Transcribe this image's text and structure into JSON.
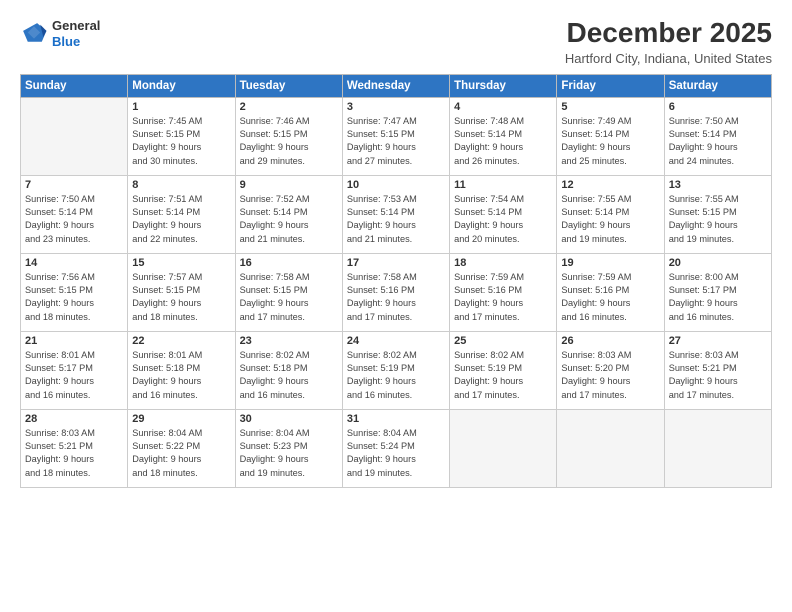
{
  "header": {
    "logo_line1": "General",
    "logo_line2": "Blue",
    "month": "December 2025",
    "location": "Hartford City, Indiana, United States"
  },
  "weekdays": [
    "Sunday",
    "Monday",
    "Tuesday",
    "Wednesday",
    "Thursday",
    "Friday",
    "Saturday"
  ],
  "weeks": [
    [
      {
        "num": "",
        "detail": ""
      },
      {
        "num": "1",
        "detail": "Sunrise: 7:45 AM\nSunset: 5:15 PM\nDaylight: 9 hours\nand 30 minutes."
      },
      {
        "num": "2",
        "detail": "Sunrise: 7:46 AM\nSunset: 5:15 PM\nDaylight: 9 hours\nand 29 minutes."
      },
      {
        "num": "3",
        "detail": "Sunrise: 7:47 AM\nSunset: 5:15 PM\nDaylight: 9 hours\nand 27 minutes."
      },
      {
        "num": "4",
        "detail": "Sunrise: 7:48 AM\nSunset: 5:14 PM\nDaylight: 9 hours\nand 26 minutes."
      },
      {
        "num": "5",
        "detail": "Sunrise: 7:49 AM\nSunset: 5:14 PM\nDaylight: 9 hours\nand 25 minutes."
      },
      {
        "num": "6",
        "detail": "Sunrise: 7:50 AM\nSunset: 5:14 PM\nDaylight: 9 hours\nand 24 minutes."
      }
    ],
    [
      {
        "num": "7",
        "detail": "Sunrise: 7:50 AM\nSunset: 5:14 PM\nDaylight: 9 hours\nand 23 minutes."
      },
      {
        "num": "8",
        "detail": "Sunrise: 7:51 AM\nSunset: 5:14 PM\nDaylight: 9 hours\nand 22 minutes."
      },
      {
        "num": "9",
        "detail": "Sunrise: 7:52 AM\nSunset: 5:14 PM\nDaylight: 9 hours\nand 21 minutes."
      },
      {
        "num": "10",
        "detail": "Sunrise: 7:53 AM\nSunset: 5:14 PM\nDaylight: 9 hours\nand 21 minutes."
      },
      {
        "num": "11",
        "detail": "Sunrise: 7:54 AM\nSunset: 5:14 PM\nDaylight: 9 hours\nand 20 minutes."
      },
      {
        "num": "12",
        "detail": "Sunrise: 7:55 AM\nSunset: 5:14 PM\nDaylight: 9 hours\nand 19 minutes."
      },
      {
        "num": "13",
        "detail": "Sunrise: 7:55 AM\nSunset: 5:15 PM\nDaylight: 9 hours\nand 19 minutes."
      }
    ],
    [
      {
        "num": "14",
        "detail": "Sunrise: 7:56 AM\nSunset: 5:15 PM\nDaylight: 9 hours\nand 18 minutes."
      },
      {
        "num": "15",
        "detail": "Sunrise: 7:57 AM\nSunset: 5:15 PM\nDaylight: 9 hours\nand 18 minutes."
      },
      {
        "num": "16",
        "detail": "Sunrise: 7:58 AM\nSunset: 5:15 PM\nDaylight: 9 hours\nand 17 minutes."
      },
      {
        "num": "17",
        "detail": "Sunrise: 7:58 AM\nSunset: 5:16 PM\nDaylight: 9 hours\nand 17 minutes."
      },
      {
        "num": "18",
        "detail": "Sunrise: 7:59 AM\nSunset: 5:16 PM\nDaylight: 9 hours\nand 17 minutes."
      },
      {
        "num": "19",
        "detail": "Sunrise: 7:59 AM\nSunset: 5:16 PM\nDaylight: 9 hours\nand 16 minutes."
      },
      {
        "num": "20",
        "detail": "Sunrise: 8:00 AM\nSunset: 5:17 PM\nDaylight: 9 hours\nand 16 minutes."
      }
    ],
    [
      {
        "num": "21",
        "detail": "Sunrise: 8:01 AM\nSunset: 5:17 PM\nDaylight: 9 hours\nand 16 minutes."
      },
      {
        "num": "22",
        "detail": "Sunrise: 8:01 AM\nSunset: 5:18 PM\nDaylight: 9 hours\nand 16 minutes."
      },
      {
        "num": "23",
        "detail": "Sunrise: 8:02 AM\nSunset: 5:18 PM\nDaylight: 9 hours\nand 16 minutes."
      },
      {
        "num": "24",
        "detail": "Sunrise: 8:02 AM\nSunset: 5:19 PM\nDaylight: 9 hours\nand 16 minutes."
      },
      {
        "num": "25",
        "detail": "Sunrise: 8:02 AM\nSunset: 5:19 PM\nDaylight: 9 hours\nand 17 minutes."
      },
      {
        "num": "26",
        "detail": "Sunrise: 8:03 AM\nSunset: 5:20 PM\nDaylight: 9 hours\nand 17 minutes."
      },
      {
        "num": "27",
        "detail": "Sunrise: 8:03 AM\nSunset: 5:21 PM\nDaylight: 9 hours\nand 17 minutes."
      }
    ],
    [
      {
        "num": "28",
        "detail": "Sunrise: 8:03 AM\nSunset: 5:21 PM\nDaylight: 9 hours\nand 18 minutes."
      },
      {
        "num": "29",
        "detail": "Sunrise: 8:04 AM\nSunset: 5:22 PM\nDaylight: 9 hours\nand 18 minutes."
      },
      {
        "num": "30",
        "detail": "Sunrise: 8:04 AM\nSunset: 5:23 PM\nDaylight: 9 hours\nand 19 minutes."
      },
      {
        "num": "31",
        "detail": "Sunrise: 8:04 AM\nSunset: 5:24 PM\nDaylight: 9 hours\nand 19 minutes."
      },
      {
        "num": "",
        "detail": ""
      },
      {
        "num": "",
        "detail": ""
      },
      {
        "num": "",
        "detail": ""
      }
    ]
  ]
}
